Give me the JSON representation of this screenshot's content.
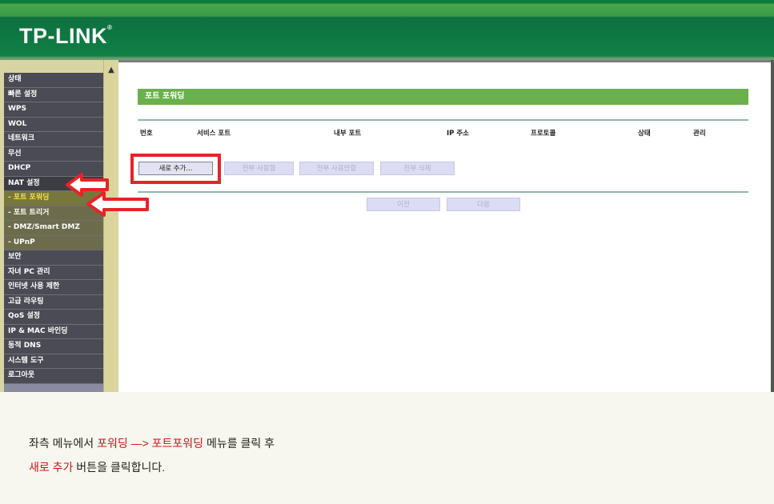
{
  "brand": {
    "logo_text": "TP-LINK",
    "trademark": "®"
  },
  "sidebar": {
    "items": [
      {
        "label": "상태",
        "type": "top"
      },
      {
        "label": "빠른 설정",
        "type": "top"
      },
      {
        "label": "WPS",
        "type": "top"
      },
      {
        "label": "WOL",
        "type": "top"
      },
      {
        "label": "네트워크",
        "type": "top"
      },
      {
        "label": "무선",
        "type": "top"
      },
      {
        "label": "DHCP",
        "type": "top"
      },
      {
        "label": "NAT 설정",
        "type": "active"
      },
      {
        "label": "- 포트 포워딩",
        "type": "sub-selected"
      },
      {
        "label": "- 포트 트리거",
        "type": "sub"
      },
      {
        "label": "- DMZ/Smart DMZ",
        "type": "sub"
      },
      {
        "label": "- UPnP",
        "type": "sub"
      },
      {
        "label": "보안",
        "type": "top"
      },
      {
        "label": "자녀 PC 관리",
        "type": "top"
      },
      {
        "label": "인터넷 사용 제한",
        "type": "top"
      },
      {
        "label": "고급 라우팅",
        "type": "top"
      },
      {
        "label": "QoS 설정",
        "type": "top"
      },
      {
        "label": "IP & MAC 바인딩",
        "type": "top"
      },
      {
        "label": "동적 DNS",
        "type": "top"
      },
      {
        "label": "시스템 도구",
        "type": "top"
      },
      {
        "label": "로그아웃",
        "type": "top"
      }
    ]
  },
  "main": {
    "title": "포트 포워딩",
    "columns": [
      "번호",
      "서비스 포트",
      "내부 포트",
      "IP 주소",
      "프로토콜",
      "상태",
      "관리"
    ],
    "buttons": {
      "add": "새로 추가...",
      "enable_all": "전부 사용함",
      "disable_all": "전부 사용안함",
      "delete_all": "전부 삭제",
      "prev": "이전",
      "next": "다음"
    }
  },
  "caption": {
    "line1_prefix": "좌측 메뉴에서 ",
    "line1_red1": "포워딩 —> 포트포워딩",
    "line1_suffix": " 메뉴를   클릭 후",
    "line2_red": "새로 추가",
    "line2_suffix": " 버튼을 클릭합니다."
  },
  "colors": {
    "highlight": "#e8222a",
    "title_bar": "#6ab04c",
    "caption_red": "#d0141a"
  }
}
